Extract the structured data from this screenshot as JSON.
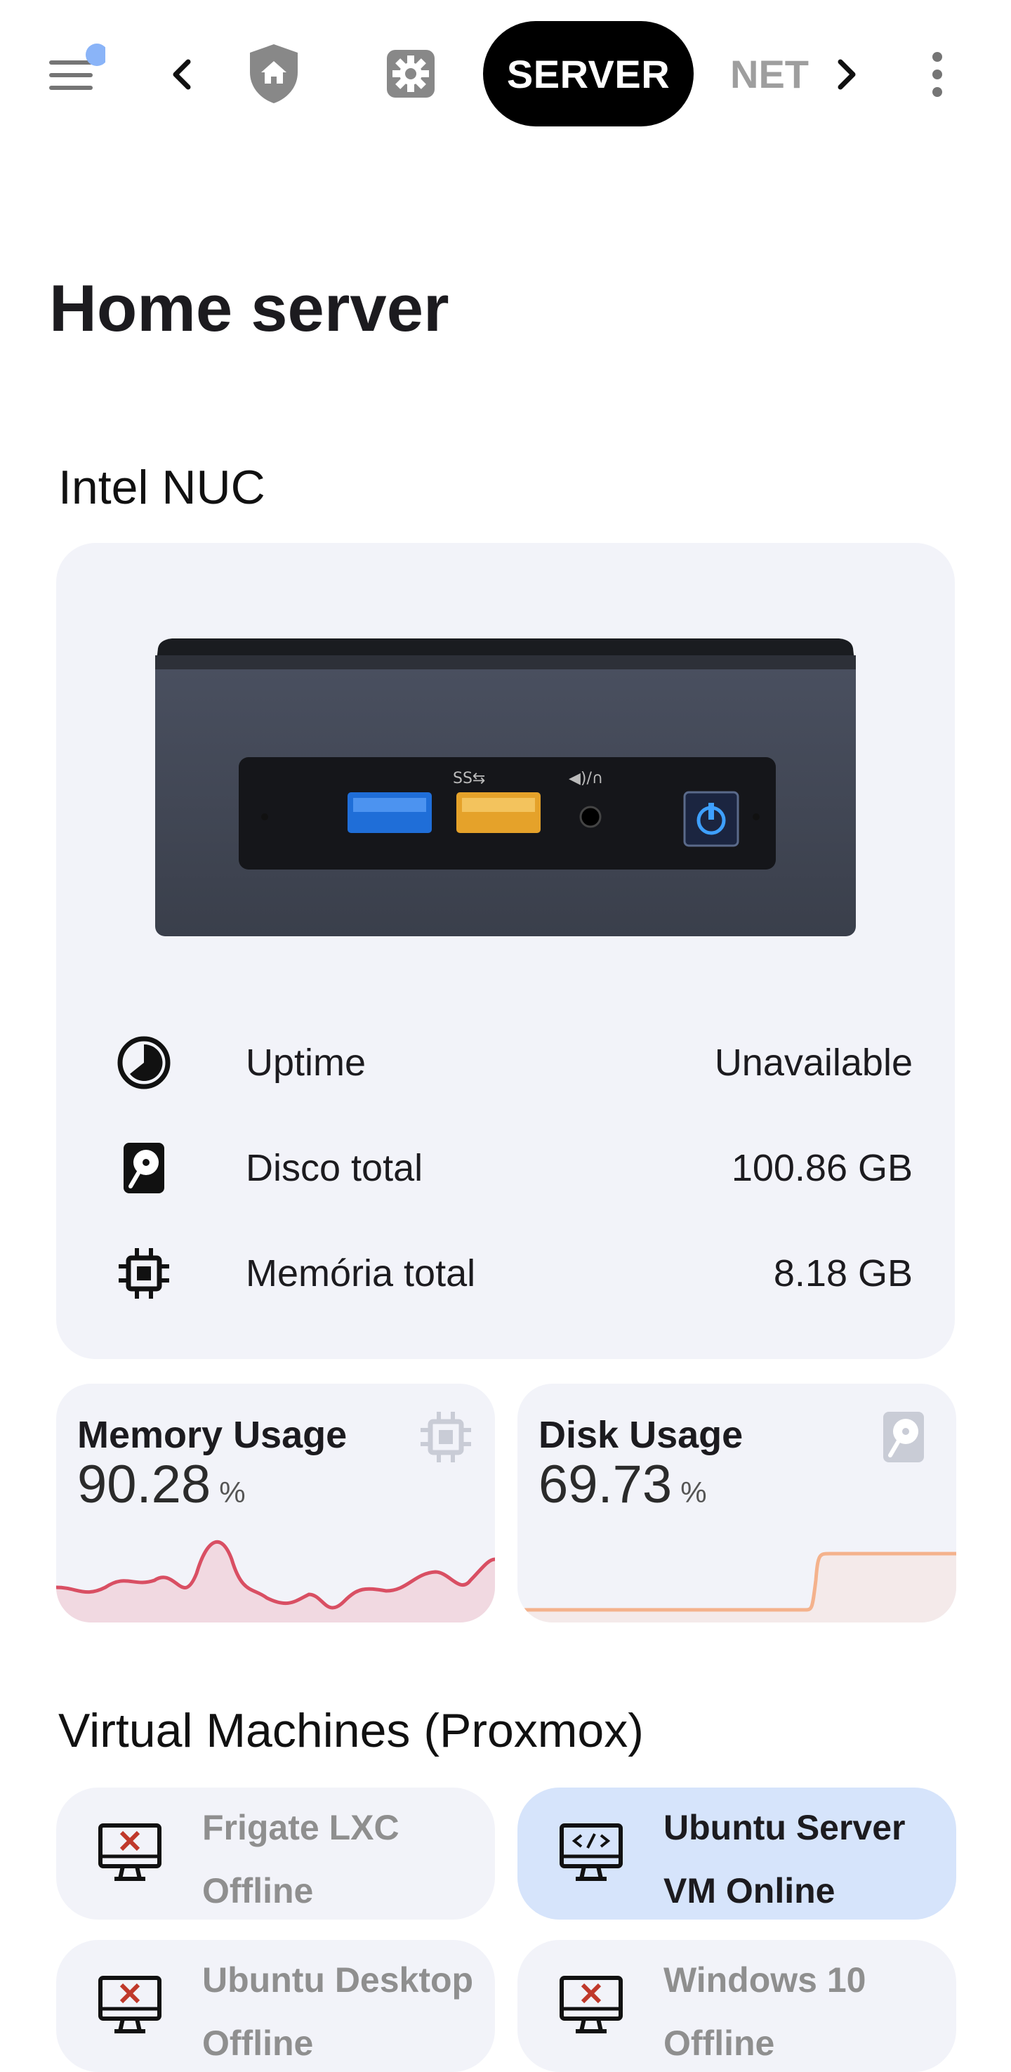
{
  "topbar": {
    "menu_icon": "hamburger-menu-icon",
    "notification_dot_color": "#8ab4f8",
    "back_icon": "chevron-left-icon",
    "tabs": [
      {
        "icon": "shield-home-icon"
      },
      {
        "icon": "gear-icon"
      },
      {
        "label": "SERVER",
        "selected": true
      },
      {
        "label": "NET",
        "selected": false
      }
    ],
    "next_icon": "chevron-right-icon",
    "more_icon": "more-vertical-icon"
  },
  "page": {
    "title": "Home server"
  },
  "device": {
    "section_title": "Intel NUC",
    "rows": [
      {
        "icon": "clock-icon",
        "label": "Uptime",
        "value": "Unavailable"
      },
      {
        "icon": "harddisk-icon",
        "label": "Disco total",
        "value": "100.86 GB"
      },
      {
        "icon": "chip-icon",
        "label": "Memória total",
        "value": "8.18 GB"
      }
    ]
  },
  "usage": {
    "memory": {
      "label": "Memory Usage",
      "value": "90.28",
      "unit": "%",
      "icon": "chip-icon",
      "line_color": "#d94f63",
      "fill_color": "#f1d9e1"
    },
    "disk": {
      "label": "Disk Usage",
      "value": "69.73",
      "unit": "%",
      "icon": "harddisk-icon",
      "line_color": "#f4b28c",
      "fill_color": "#f4eaea"
    }
  },
  "vms": {
    "section_title": "Virtual Machines (Proxmox)",
    "items": [
      {
        "name": "Frigate LXC",
        "status": "Offline",
        "icon": "monitor-off-icon",
        "active": false
      },
      {
        "name": "Ubuntu Server",
        "status": "VM Online",
        "icon": "monitor-code-icon",
        "active": true
      },
      {
        "name": "Ubuntu Desktop",
        "status": "Offline",
        "icon": "monitor-off-icon",
        "active": false
      },
      {
        "name": "Windows 10",
        "status": "Offline",
        "icon": "monitor-off-icon",
        "active": false
      }
    ]
  }
}
